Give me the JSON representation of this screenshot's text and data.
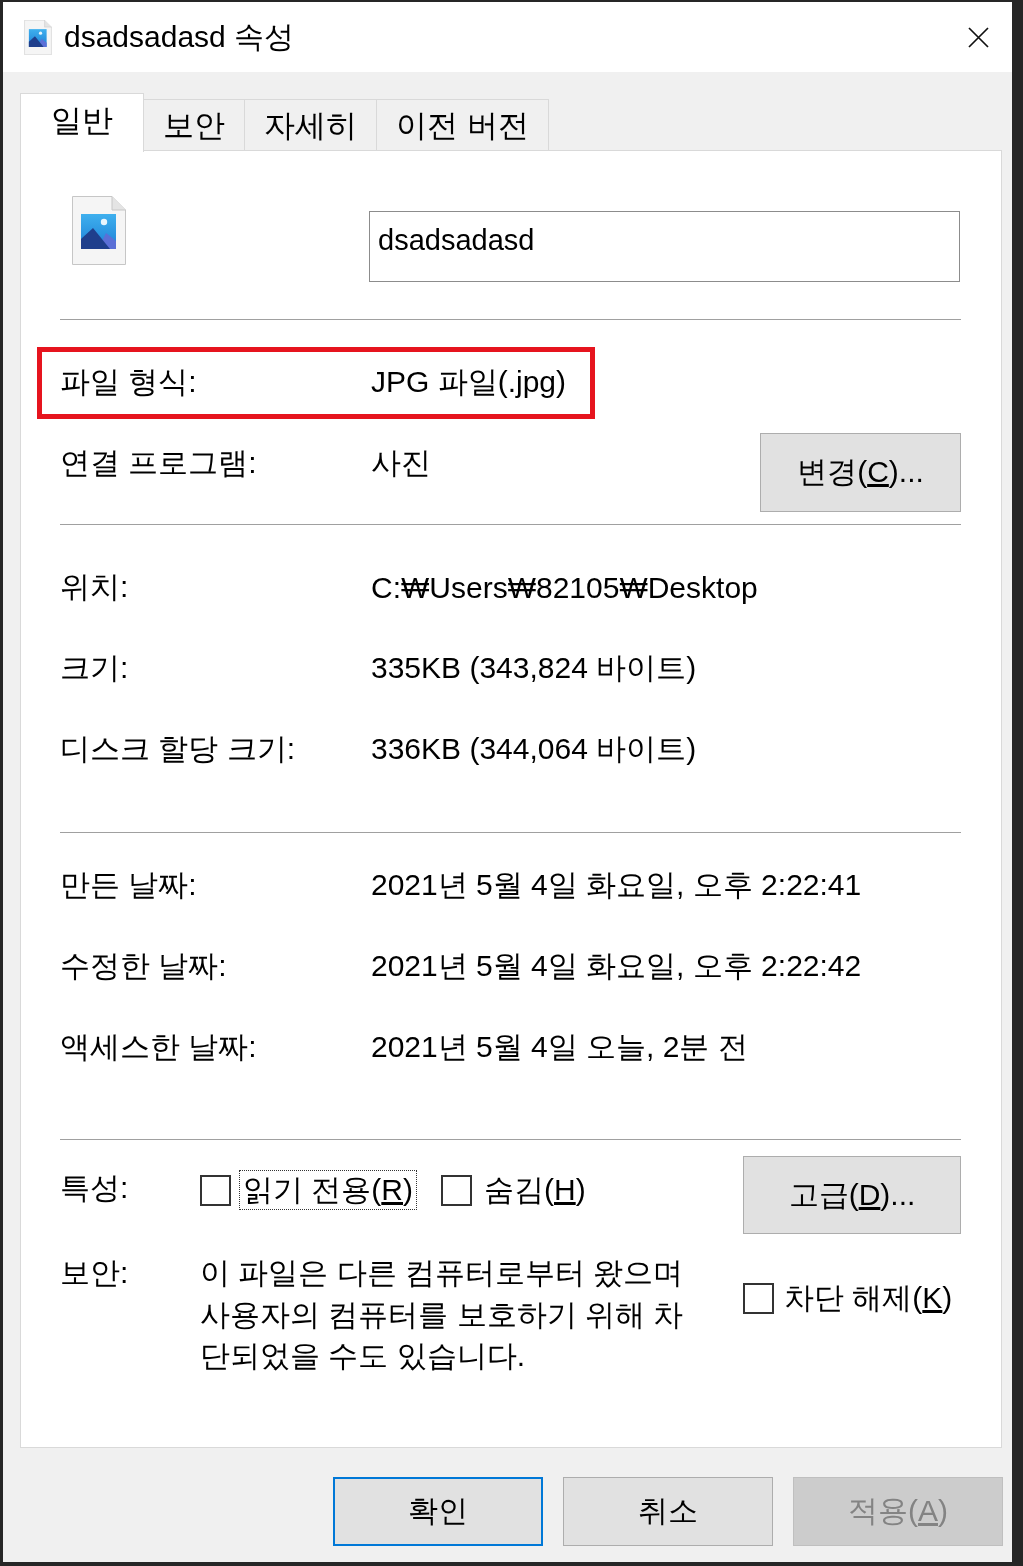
{
  "window": {
    "title": "dsadsadasd 속성"
  },
  "tabs": [
    {
      "label": "일반",
      "selected": true
    },
    {
      "label": "보안",
      "selected": false
    },
    {
      "label": "자세히",
      "selected": false
    },
    {
      "label": "이전 버전",
      "selected": false
    }
  ],
  "header": {
    "file_name": "dsadsadasd"
  },
  "sections": [
    {
      "rows": [
        {
          "kind": "field",
          "label": "파일 형식:",
          "value": "JPG 파일(.jpg)",
          "highlighted": true
        },
        {
          "kind": "field",
          "label": "연결 프로그램:",
          "value": "사진",
          "highlighted": false,
          "button": {
            "label": "변경(",
            "access_key": "C",
            "label_end": ")..."
          }
        }
      ]
    },
    {
      "rows": [
        {
          "kind": "field",
          "label": "위치:",
          "value": "C:₩Users₩82105₩Desktop",
          "highlighted": false
        },
        {
          "kind": "field",
          "label": "크기:",
          "value": "335KB (343,824 바이트)",
          "highlighted": false
        },
        {
          "kind": "field",
          "label": "디스크 할당 크기:",
          "value": "336KB (344,064 바이트)",
          "highlighted": false
        }
      ]
    },
    {
      "rows": [
        {
          "kind": "field",
          "label": "만든 날짜:",
          "value": "2021년 5월 4일 화요일, 오후 2:22:41",
          "highlighted": false
        },
        {
          "kind": "field",
          "label": "수정한 날짜:",
          "value": "2021년 5월 4일 화요일, 오후 2:22:42",
          "highlighted": false
        },
        {
          "kind": "field",
          "label": "액세스한 날짜:",
          "value": "2021년 5월 4일 오늘, 2분 전",
          "highlighted": false
        }
      ]
    },
    {
      "rows": [
        {
          "kind": "attributes",
          "label": "특성:",
          "checkboxes": [
            {
              "label": "읽기 전용(",
              "access_key": "R",
              "label_end": ")",
              "checked": false,
              "focused": true
            },
            {
              "label": "숨김(",
              "access_key": "H",
              "label_end": ")",
              "checked": false,
              "focused": false
            }
          ],
          "button": {
            "label": "고급(",
            "access_key": "D",
            "label_end": ")..."
          }
        },
        {
          "kind": "security",
          "label": "보안:",
          "text": "이 파일은 다른 컴퓨터로부터 왔으며 사용자의 컴퓨터를 보호하기 위해 차단되었을 수도 있습니다.",
          "checkbox": {
            "label": "차단 해제(",
            "access_key": "K",
            "label_end": ")",
            "checked": false,
            "focused": false
          }
        }
      ]
    }
  ],
  "buttons": [
    {
      "label": "확인",
      "default": true,
      "disabled": false
    },
    {
      "label": "취소",
      "default": false,
      "disabled": false
    },
    {
      "label": "적용(",
      "access_key": "A",
      "label_end": ")",
      "default": false,
      "disabled": true
    }
  ]
}
